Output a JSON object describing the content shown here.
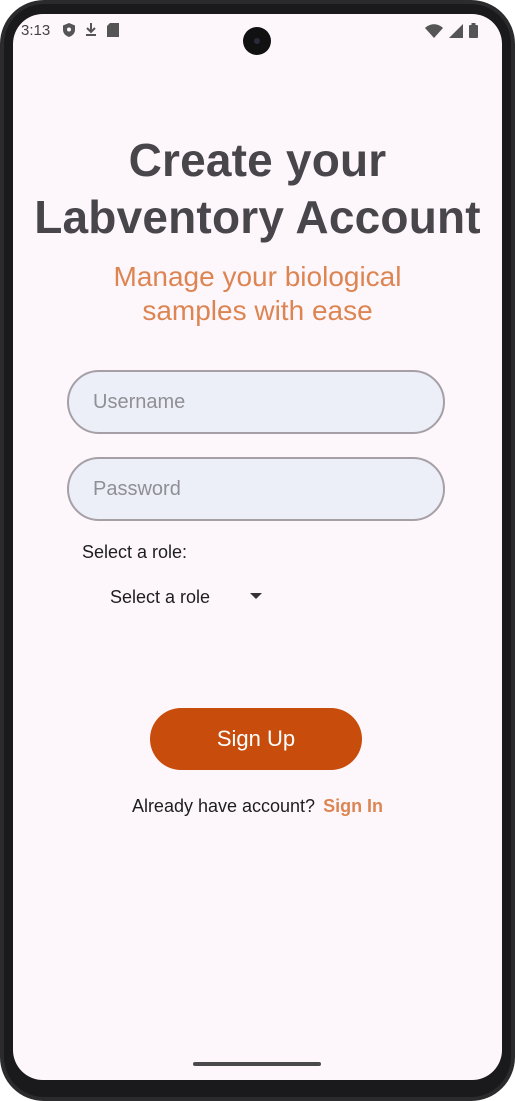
{
  "status_bar": {
    "time": "3:13",
    "left_icons": [
      "shield-icon",
      "download-icon",
      "sd-card-icon"
    ],
    "right_icons": [
      "wifi-icon",
      "signal-icon",
      "battery-icon"
    ]
  },
  "header": {
    "title_line1": "Create your",
    "title_line2": "Labventory Account",
    "subtitle_line1": "Manage your biological",
    "subtitle_line2": "samples with ease"
  },
  "form": {
    "username_placeholder": "Username",
    "username_value": "",
    "password_placeholder": "Password",
    "password_value": "",
    "role_label": "Select a role:",
    "role_selected": "Select a role"
  },
  "actions": {
    "signup_label": "Sign Up",
    "signin_prompt": "Already have account?",
    "signin_link": "Sign In"
  },
  "colors": {
    "background": "#fdf7fc",
    "title": "#48464b",
    "accent": "#dd8552",
    "button": "#c84d0c",
    "field_bg": "#eceff8",
    "field_border": "#a79fa6"
  }
}
